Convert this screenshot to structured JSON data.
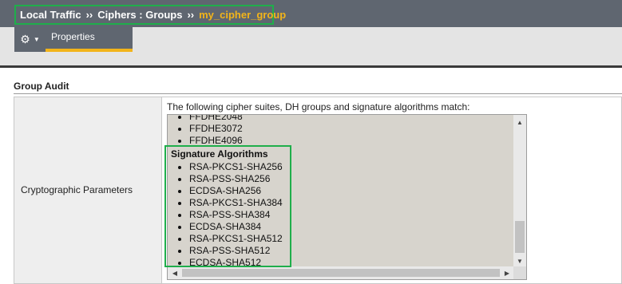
{
  "breadcrumb": {
    "items": [
      "Local Traffic",
      "Ciphers : Groups"
    ],
    "separator": "››",
    "current": "my_cipher_group"
  },
  "toolbar": {
    "gear_icon": "gear-icon",
    "tabs": [
      {
        "label": "Properties",
        "active": true
      }
    ]
  },
  "section": {
    "title": "Group Audit",
    "row_label": "Cryptographic Parameters",
    "intro": "The following cipher suites, DH groups and signature algorithms match:"
  },
  "listbox": {
    "dh_groups": [
      "FFDHE2048",
      "FFDHE3072",
      "FFDHE4096"
    ],
    "signature_heading": "Signature Algorithms",
    "signature_algorithms": [
      "RSA-PKCS1-SHA256",
      "RSA-PSS-SHA256",
      "ECDSA-SHA256",
      "RSA-PKCS1-SHA384",
      "RSA-PSS-SHA384",
      "ECDSA-SHA384",
      "RSA-PKCS1-SHA512",
      "RSA-PSS-SHA512",
      "ECDSA-SHA512"
    ]
  },
  "colors": {
    "header_bg": "#5f6670",
    "accent": "#f2b41a",
    "highlight": "#1fae4b",
    "listbox_bg": "#d7d4cd"
  }
}
